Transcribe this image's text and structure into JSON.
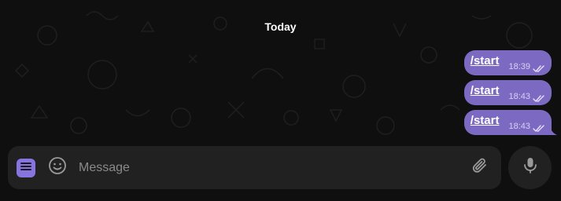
{
  "chat": {
    "date_label": "Today",
    "messages": [
      {
        "text": "/start",
        "time": "18:39"
      },
      {
        "text": "/start",
        "time": "18:43"
      },
      {
        "text": "/start",
        "time": "18:43"
      }
    ]
  },
  "composer": {
    "placeholder": "Message"
  },
  "icons": {
    "menu": "menu-icon",
    "emoji": "smile-icon",
    "attach": "paperclip-icon",
    "voice": "microphone-icon",
    "read_status": "double-check-icon"
  },
  "colors": {
    "background": "#0f0f0f",
    "bubble": "#7c6ac2",
    "accent": "#8774e1",
    "composer": "#212121"
  }
}
